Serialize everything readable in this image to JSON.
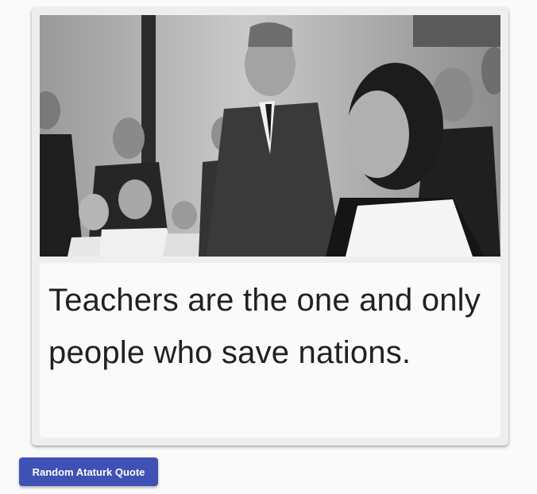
{
  "quote": {
    "text": "Teachers are the one and only people who save nations."
  },
  "image": {
    "subject": "black-and-white photograph"
  },
  "actions": {
    "random_quote_label": "Random Ataturk Quote"
  },
  "colors": {
    "page_background": "#fafafa",
    "card_background": "#eeeeee",
    "button_primary": "#3f51b5",
    "button_text": "#ffffff",
    "quote_text": "#212121"
  }
}
